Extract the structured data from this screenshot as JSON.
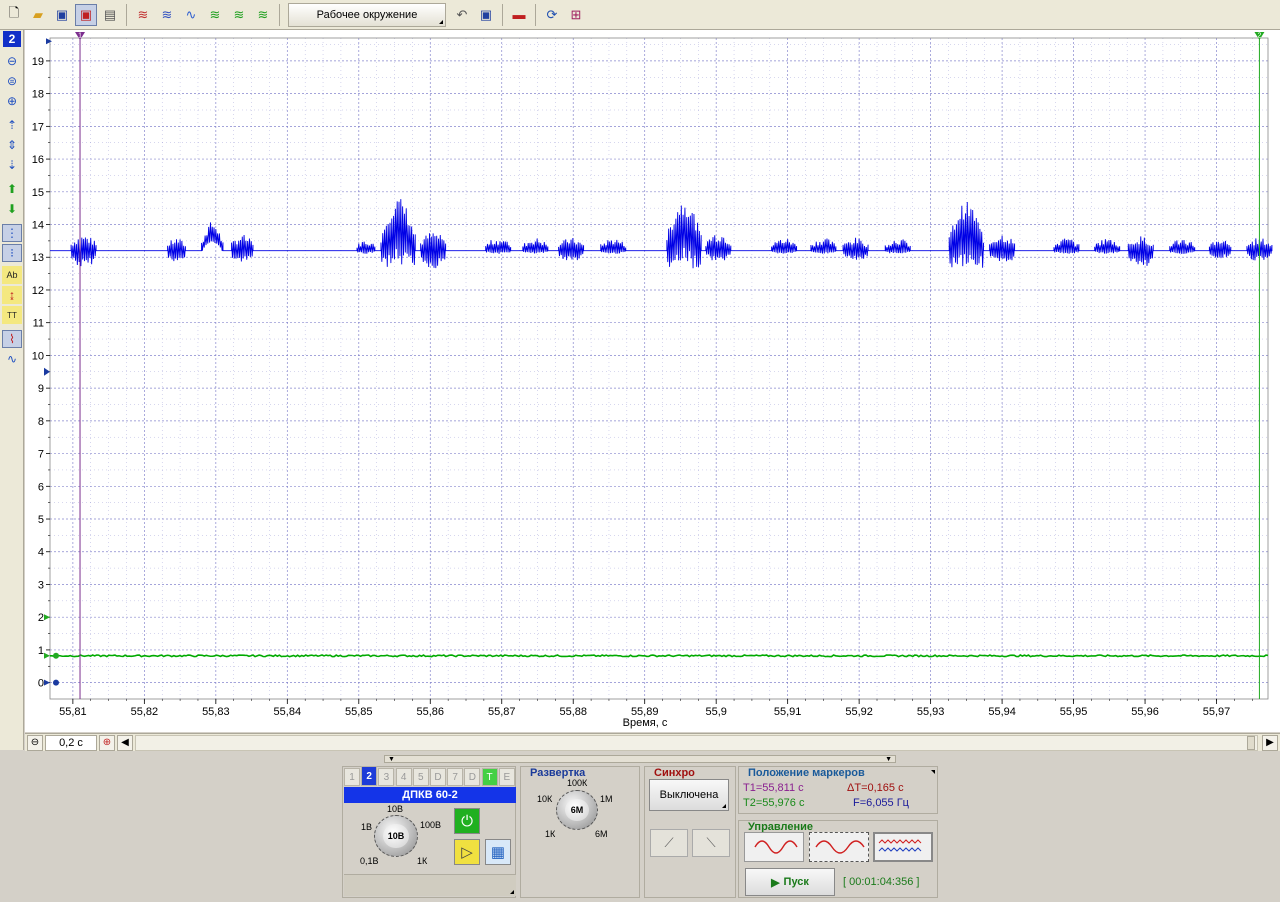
{
  "toolbar": {
    "workspace_label": "Рабочее окружение",
    "icons": [
      "new-file-icon",
      "open-folder-icon",
      "save-icon",
      "save-as-icon",
      "print-icon",
      "signal-icon",
      "signals-icon",
      "wave-icon",
      "check-signal-icon",
      "signal-number-icon",
      "signal-settings-icon",
      "undo-icon",
      "save-workspace-icon",
      "car-icon",
      "refresh-icon",
      "fit-icon"
    ]
  },
  "left_toolbar": {
    "channel_number": "2",
    "icons": [
      "zoom-out-vertical-icon",
      "zoom-reset-icon",
      "zoom-in-vertical-icon",
      "shift-up-icon",
      "expand-icon",
      "shift-down-icon",
      "arrow-up-icon",
      "arrow-down-icon",
      "cursor-mode-icon",
      "cursor-mode2-icon",
      "text-label-icon",
      "marker-levels-icon",
      "time-markers-icon",
      "chart-view-icon",
      "chart-view2-icon"
    ]
  },
  "plot": {
    "xlabel": "Время, с",
    "y_ticks": [
      "0",
      "1",
      "2",
      "3",
      "4",
      "5",
      "6",
      "7",
      "8",
      "9",
      "10",
      "11",
      "12",
      "13",
      "14",
      "15",
      "16",
      "17",
      "18",
      "19"
    ],
    "x_ticks": [
      "55,81",
      "55,82",
      "55,83",
      "55,84",
      "55,85",
      "55,86",
      "55,87",
      "55,88",
      "55,89",
      "55,9",
      "55,91",
      "55,92",
      "55,93",
      "55,94",
      "55,95",
      "55,96",
      "55,97"
    ],
    "marker1_label": "1",
    "marker2_label": "2",
    "colors": {
      "channel_blue": "#0000e6",
      "channel_green": "#00aa00",
      "marker1": "#7b2d8e",
      "marker2": "#22aa22",
      "grid": "#7a7ac8"
    }
  },
  "chart_data": {
    "type": "line",
    "x_range": [
      55.8068,
      55.9772
    ],
    "ylim": [
      -0.5,
      19.7
    ],
    "xlabel": "Время, с",
    "grid": true,
    "series": [
      {
        "baseline": 13.2,
        "color": "#0000e6",
        "bursts": [
          {
            "t": 55.8115,
            "w": 0.0035,
            "up": 0.5,
            "down": 0.55
          },
          {
            "t": 55.8245,
            "w": 0.0025,
            "up": 0.4,
            "down": 0.45
          },
          {
            "t": 55.8295,
            "w": 0.003,
            "up": 0.55,
            "down": 0.1,
            "hump": 0.35
          },
          {
            "t": 55.8337,
            "w": 0.003,
            "up": 0.5,
            "down": 0.4
          },
          {
            "t": 55.851,
            "w": 0.0025,
            "up": 0.35,
            "down": 0.1
          },
          {
            "t": 55.8555,
            "w": 0.0048,
            "up": 1.05,
            "down": 1.2,
            "hump": 0.6
          },
          {
            "t": 55.8604,
            "w": 0.0035,
            "up": 0.6,
            "down": 0.55
          },
          {
            "t": 55.8695,
            "w": 0.0035,
            "up": 0.4,
            "down": 0.1
          },
          {
            "t": 55.8747,
            "w": 0.0035,
            "up": 0.4,
            "down": 0.1
          },
          {
            "t": 55.8797,
            "w": 0.0035,
            "up": 0.4,
            "down": 0.35
          },
          {
            "t": 55.8856,
            "w": 0.0035,
            "up": 0.4,
            "down": 0.1
          },
          {
            "t": 55.8955,
            "w": 0.0048,
            "up": 1.0,
            "down": 1.15,
            "hump": 0.6
          },
          {
            "t": 55.9003,
            "w": 0.0035,
            "up": 0.6,
            "down": 0.35
          },
          {
            "t": 55.9095,
            "w": 0.0035,
            "up": 0.4,
            "down": 0.1
          },
          {
            "t": 55.915,
            "w": 0.0035,
            "up": 0.4,
            "down": 0.1
          },
          {
            "t": 55.9195,
            "w": 0.0035,
            "up": 0.4,
            "down": 0.35
          },
          {
            "t": 55.9254,
            "w": 0.0035,
            "up": 0.4,
            "down": 0.1
          },
          {
            "t": 55.935,
            "w": 0.0048,
            "up": 0.95,
            "down": 1.05,
            "hump": 0.55
          },
          {
            "t": 55.94,
            "w": 0.0035,
            "up": 0.55,
            "down": 0.45
          },
          {
            "t": 55.949,
            "w": 0.0035,
            "up": 0.4,
            "down": 0.1
          },
          {
            "t": 55.9547,
            "w": 0.0035,
            "up": 0.4,
            "down": 0.1
          },
          {
            "t": 55.9594,
            "w": 0.0035,
            "up": 0.45,
            "down": 0.55
          },
          {
            "t": 55.9652,
            "w": 0.0035,
            "up": 0.4,
            "down": 0.1
          },
          {
            "t": 55.9705,
            "w": 0.003,
            "up": 0.4,
            "down": 0.25
          },
          {
            "t": 55.976,
            "w": 0.0035,
            "up": 0.4,
            "down": 0.35
          }
        ]
      },
      {
        "baseline": 0.82,
        "color": "#00aa00"
      }
    ],
    "markers": [
      {
        "label": "1",
        "t": 55.811,
        "color": "#7b2d8e"
      },
      {
        "label": "2",
        "t": 55.976,
        "color": "#22aa22"
      }
    ]
  },
  "scrollbar": {
    "zoom_value": "0,2 с"
  },
  "channel_panel": {
    "tabs": [
      "1",
      "2",
      "3",
      "4",
      "5",
      "D",
      "7",
      "D",
      "T",
      "E"
    ],
    "active_tab": "2",
    "channel_name": "ДПКВ 60-2",
    "knob_labels": {
      "top": "10В",
      "left": "1В",
      "right": "100В",
      "bottom_left": "0,1В",
      "bottom_right": "1К",
      "center": "10В"
    }
  },
  "sweep_panel": {
    "title": "Развертка",
    "knob_labels": {
      "top": "100К",
      "left": "10К",
      "right": "1М",
      "bottom_left": "1К",
      "bottom_right": "6М",
      "center": "6М"
    }
  },
  "sync_panel": {
    "title": "Синхро",
    "state": "Выключена"
  },
  "markers_panel": {
    "title": "Положение маркеров",
    "t1": "T1=55,811 с",
    "dt": "ΔT=0,165 с",
    "t2": "T2=55,976 с",
    "f": "F=6,055 Гц"
  },
  "control_panel": {
    "title": "Управление",
    "start_label": "Пуск",
    "timer": "[ 00:01:04:356 ]"
  }
}
